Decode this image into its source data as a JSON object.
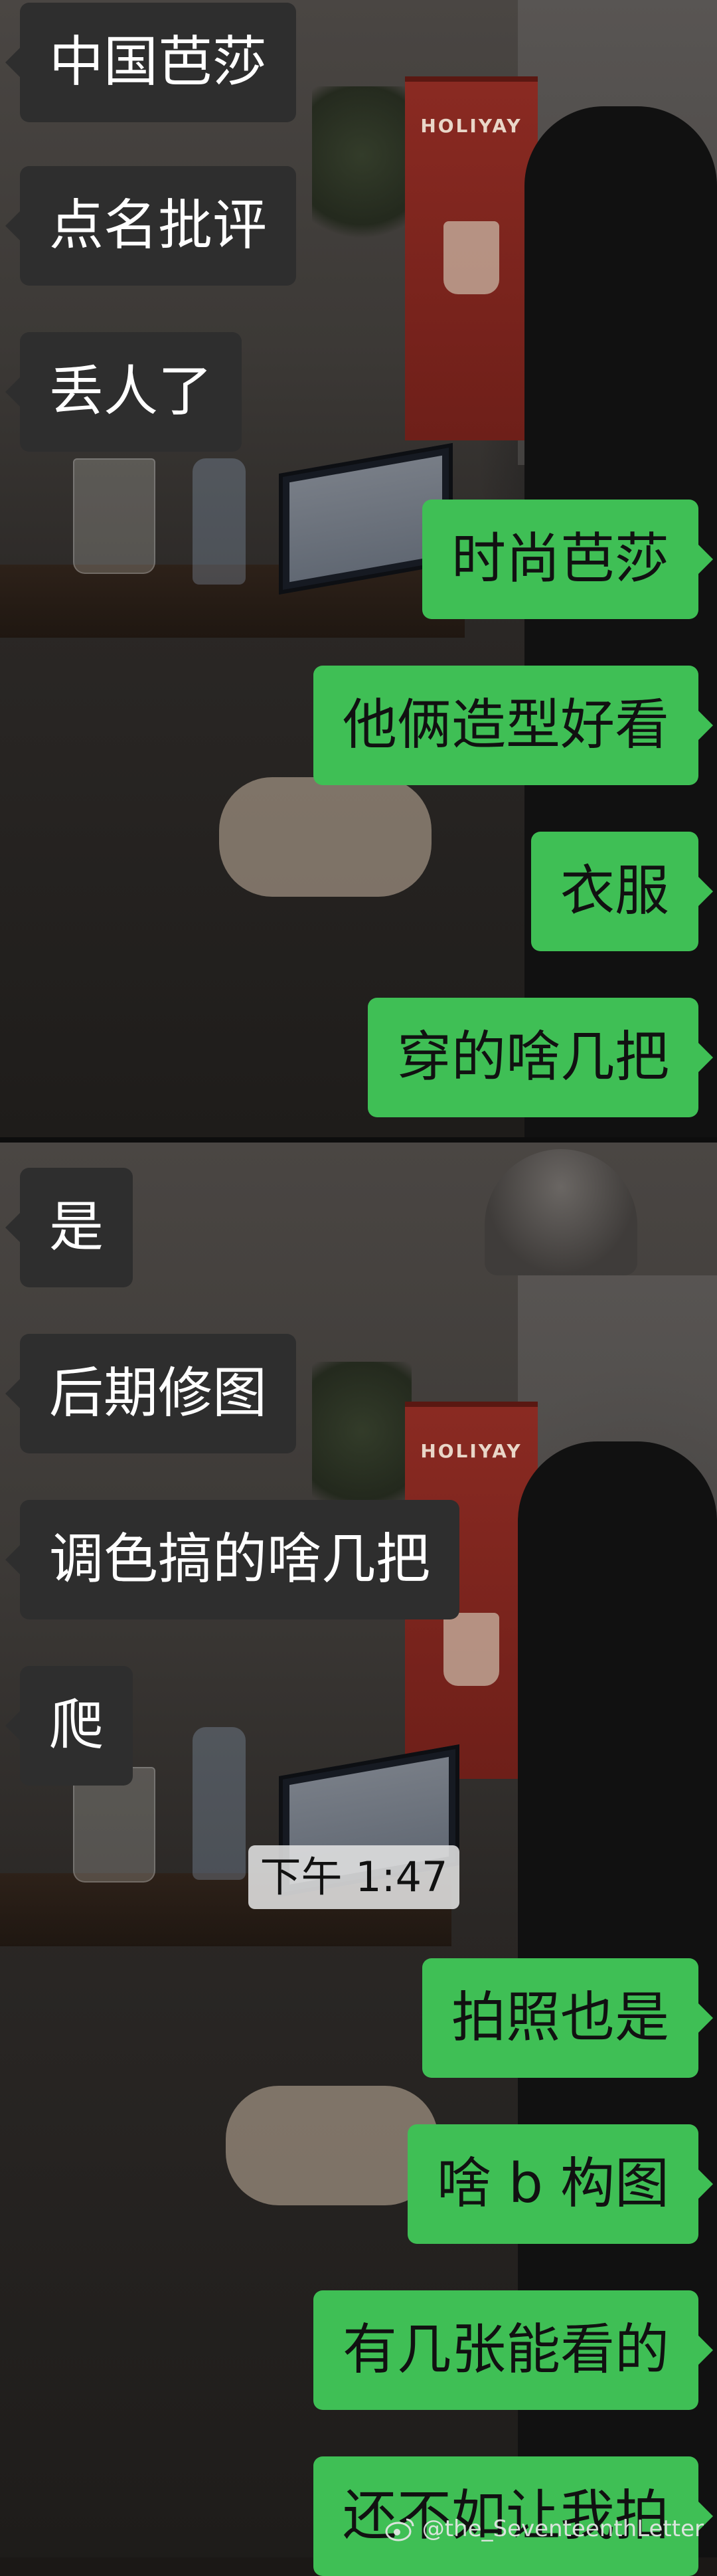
{
  "panel_1": {
    "incoming": [
      "中国芭莎",
      "点名批评",
      "丢人了"
    ],
    "outgoing": [
      "时尚芭莎",
      "他俩造型好看",
      "衣服",
      "穿的啥几把"
    ],
    "banner_text": "HOLIYAY"
  },
  "panel_2": {
    "incoming": [
      "是",
      "后期修图",
      "调色搞的啥几把",
      "爬"
    ],
    "timestamp": "下午 1:47",
    "outgoing": [
      "拍照也是",
      "啥 b 构图",
      "有几张能看的",
      "还不如让我拍"
    ],
    "banner_text": "HOLIYAY"
  },
  "watermark": {
    "icon": "weibo-icon",
    "text": "@the_SeventeenthLetter"
  },
  "colors": {
    "incoming_bubble": "#2e2e2e",
    "outgoing_bubble": "#3fbf55",
    "timestamp_bg": "#e1e1e1"
  }
}
